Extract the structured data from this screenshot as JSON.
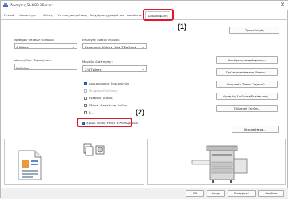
{
  "window": {
    "title": "Ιδιότητες SHARP BP-xxxx",
    "close_glyph": "✕"
  },
  "tabs": [
    {
      "label": "Γενικά"
    },
    {
      "label": "Χαρακτηρ."
    },
    {
      "label": "Θέσεις"
    },
    {
      "label": "Για προχωρημένους"
    },
    {
      "label": "Διαχείριση χρωμάτων"
    },
    {
      "label": "Ασφάλεια"
    },
    {
      "label": "Διαμόρφωση"
    }
  ],
  "callouts": {
    "tab": "(1)",
    "checkbox": "(2)"
  },
  "left_col": {
    "paper_size_label": "Ορίσιμος Θέσεων Εισόδου",
    "paper_size_value": "4 θέσεις",
    "output_label": "Δίσκος/Μον. Εκροής/αυτ.",
    "output_value": "Καθόλου"
  },
  "mid_col": {
    "input_label": "Επιλογές δίσκου εξόδου:",
    "input_value": "Κεραμικός Ρύθμισ. Βάσ.Σ.Επίλεκτ.",
    "duplex_label": "Μονάδα διάτρησης:",
    "duplex_value": "2/4 Τρύπες",
    "checkboxes": [
      {
        "label": "Δημιουργικός δημιουρτών",
        "checked": true,
        "disabled": false
      },
      {
        "label": "Μη φέρω Επίλυσης",
        "checked": false,
        "disabled": true
      },
      {
        "label": "Ενεργός δίσκος",
        "checked": false,
        "disabled": false
      },
      {
        "label": "Εξάρτ. Ασφάλειας Δεδομ.",
        "checked": false,
        "disabled": false
      },
      {
        "label": "Ρ...",
        "checked": false,
        "disabled": false
      },
      {
        "label": "Χρωμ. κοινή ατάξη εκτυπωμένων",
        "checked": true,
        "disabled": false
      }
    ]
  },
  "right_col": {
    "buttons": [
      {
        "label": "Προεπιλογές"
      },
      {
        "label": "Αυτόματη Διαμόρφωση..."
      },
      {
        "label": "Πρώτη κατάσταση δίσκου..."
      },
      {
        "label": "Ονομασία Τύπου Χαρτιού..."
      },
      {
        "label": "Ορισμός Διαδικασ/Εκτύπωσης..."
      },
      {
        "label": "Πολιτική Εκτύπ..."
      },
      {
        "label": "Περισσότερα..."
      }
    ]
  },
  "footer": {
    "buttons": [
      {
        "label": "OK"
      },
      {
        "label": "Άκυρο"
      },
      {
        "label": "Εφαρμογή"
      },
      {
        "label": "Βοήθεια"
      }
    ]
  },
  "colors": {
    "highlight": "#e3162b",
    "checkbox_checked": "#2a6fd6"
  }
}
